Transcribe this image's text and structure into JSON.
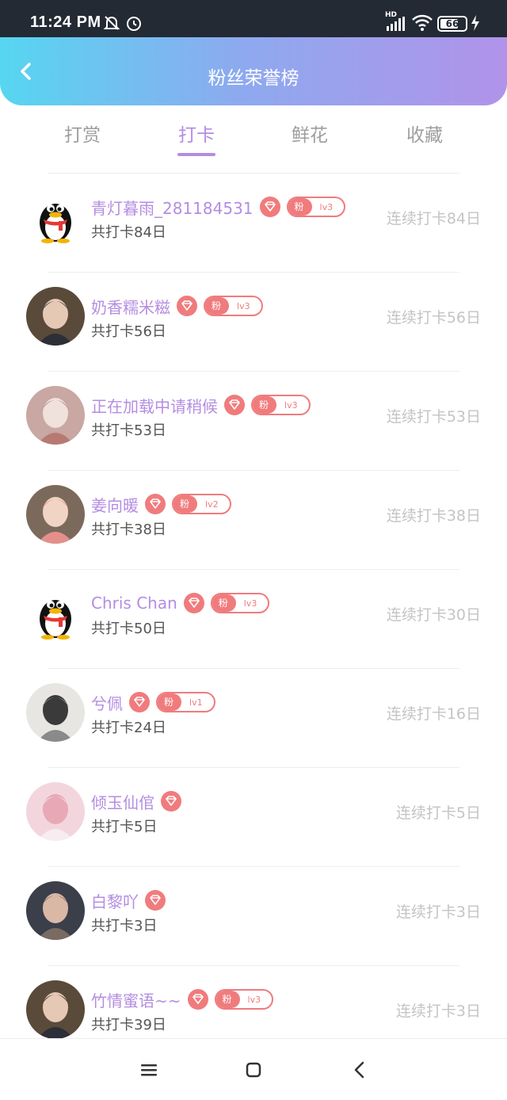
{
  "status_bar": {
    "time": "11:24 PM",
    "battery": "66",
    "network": "HD"
  },
  "header": {
    "title": "粉丝荣誉榜"
  },
  "tabs": [
    {
      "label": "打赏",
      "active": false
    },
    {
      "label": "打卡",
      "active": true
    },
    {
      "label": "鲜花",
      "active": false
    },
    {
      "label": "收藏",
      "active": false
    }
  ],
  "fans": [
    {
      "name": "青灯暮雨_281184531",
      "fan_label": "粉",
      "level": "lv3",
      "total": "共打卡84日",
      "streak": "连续打卡84日",
      "avatar": "qq-penguin"
    },
    {
      "name": "奶香糯米糍",
      "fan_label": "粉",
      "level": "lv3",
      "total": "共打卡56日",
      "streak": "连续打卡56日",
      "avatar": "photo"
    },
    {
      "name": "正在加载中请稍候",
      "fan_label": "粉",
      "level": "lv3",
      "total": "共打卡53日",
      "streak": "连续打卡53日",
      "avatar": "anime"
    },
    {
      "name": "姜向暖",
      "fan_label": "粉",
      "level": "lv2",
      "total": "共打卡38日",
      "streak": "连续打卡38日",
      "avatar": "photo"
    },
    {
      "name": "Chris Chan",
      "fan_label": "粉",
      "level": "lv3",
      "total": "共打卡50日",
      "streak": "连续打卡30日",
      "avatar": "qq-penguin"
    },
    {
      "name": "兮佩",
      "fan_label": "粉",
      "level": "lv1",
      "total": "共打卡24日",
      "streak": "连续打卡16日",
      "avatar": "anime"
    },
    {
      "name": "倾玉仙倌",
      "fan_label": "",
      "level": "",
      "total": "共打卡5日",
      "streak": "连续打卡5日",
      "avatar": "photo"
    },
    {
      "name": "白黎吖",
      "fan_label": "",
      "level": "",
      "total": "共打卡3日",
      "streak": "连续打卡3日",
      "avatar": "photo"
    },
    {
      "name": "竹情蜜语~~",
      "fan_label": "粉",
      "level": "lv3",
      "total": "共打卡39日",
      "streak": "连续打卡3日",
      "avatar": "photo"
    }
  ],
  "colors": {
    "accent": "#b48de2",
    "badge": "#f07b7d",
    "header_start": "#56d6f1",
    "header_end": "#b193e9"
  }
}
